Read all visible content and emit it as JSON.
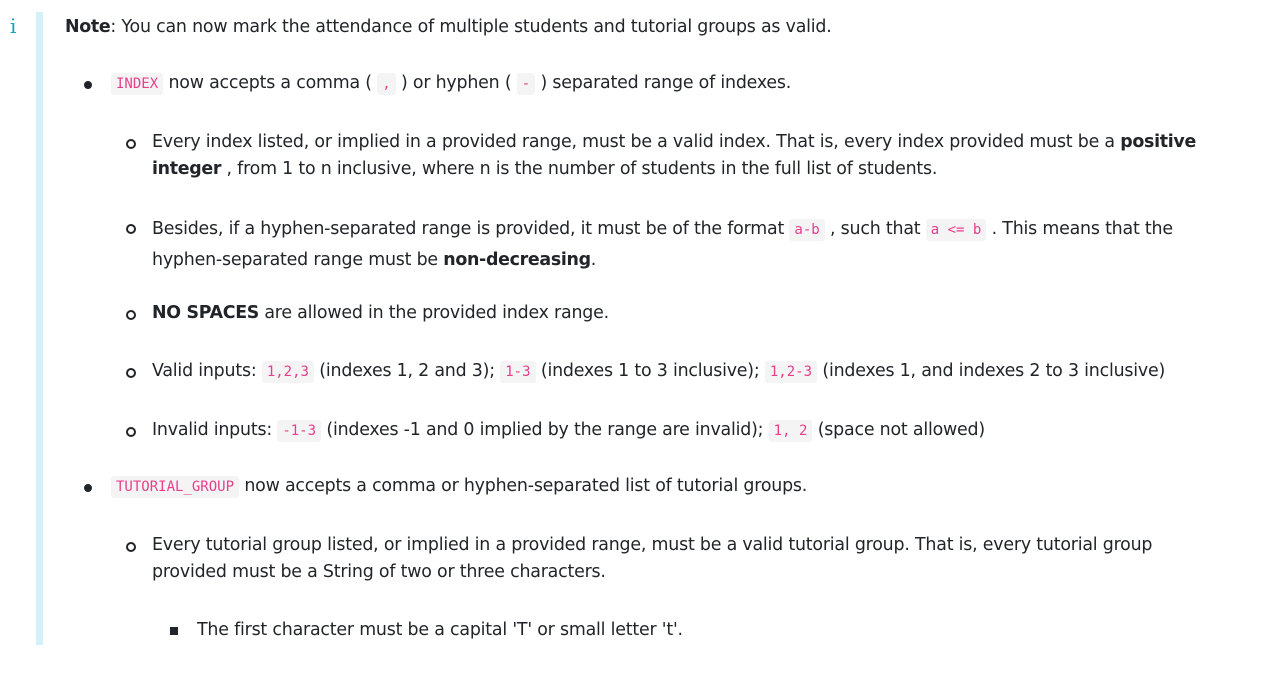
{
  "note": {
    "icon": "info-icon",
    "label": "Note",
    "text": ": You can now mark the attendance of multiple students and tutorial groups as valid."
  },
  "index_item": {
    "code": "INDEX",
    "t1": " now accepts a comma ( ",
    "comma": ",",
    "t2": " ) or hyphen ( ",
    "hyphen": "-",
    "t3": " ) separated range of indexes."
  },
  "rules": {
    "r1": {
      "t1": "Every index listed, or implied in a provided range, must be a valid index. That is, every index provided must be a ",
      "bold": "positive integer",
      "t2": " , from 1 to n inclusive, where n is the number of students in the full list of students."
    },
    "r2": {
      "t1": "Besides, if a hyphen-separated range is provided, it must be of the format ",
      "code1": "a-b",
      "t2": " , such that ",
      "code2": "a <= b",
      "t3": " . This means that the hyphen-separated range must be ",
      "bold": "non-decreasing",
      "t4": "."
    },
    "r3": {
      "bold": "NO SPACES",
      "t1": " are allowed in the provided index range."
    },
    "r4": {
      "t1": "Valid inputs: ",
      "code1": "1,2,3",
      "t2": " (indexes 1, 2 and 3); ",
      "code2": "1-3",
      "t3": " (indexes 1 to 3 inclusive); ",
      "code3": "1,2-3",
      "t4": " (indexes 1, and indexes 2 to 3 inclusive)"
    },
    "r5": {
      "t1": "Invalid inputs: ",
      "code1": "-1-3",
      "t2": " (indexes -1 and 0 implied by the range are invalid); ",
      "code2": "1, 2",
      "t3": " (space not allowed)"
    }
  },
  "tutorial_item": {
    "code": "TUTORIAL_GROUP",
    "t1": " now accepts a comma or hyphen-separated list of tutorial groups."
  },
  "tutorial_rules": {
    "r1": {
      "t1": "Every tutorial group listed, or implied in a provided range, must be a valid tutorial group. That is, every tutorial group provided must be a String of two or three characters."
    },
    "sub1": {
      "t1": "The first character must be a capital 'T' or small letter 't'."
    }
  }
}
